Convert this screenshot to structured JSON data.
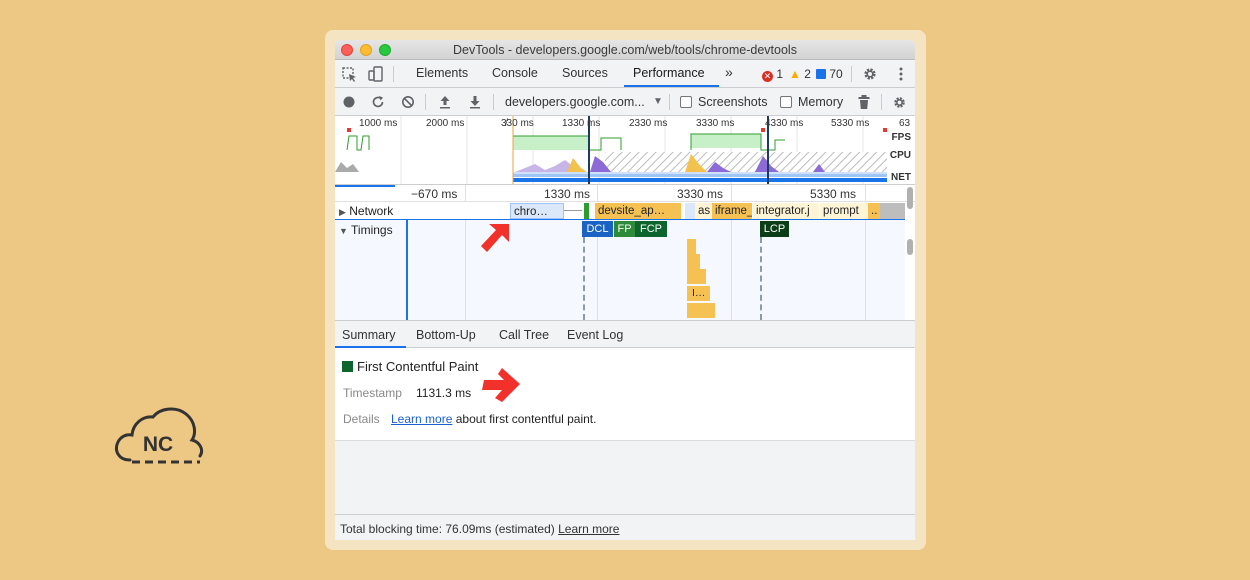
{
  "window": {
    "title": "DevTools - developers.google.com/web/tools/chrome-devtools"
  },
  "panel_tabs": [
    "Elements",
    "Console",
    "Sources",
    "Performance"
  ],
  "more_tabs_glyph": "»",
  "badges": {
    "errors": "1",
    "warnings": "2",
    "messages": "70"
  },
  "toolbar": {
    "url_select": "developers.google.com...",
    "screenshots_label": "Screenshots",
    "memory_label": "Memory"
  },
  "overview": {
    "ticks": [
      "1000 ms",
      "2000 ms",
      "3̸30 ms",
      "1330 ms",
      "2330 ms",
      "3330 ms",
      "4330 ms",
      "5330 ms",
      "63"
    ],
    "labels": {
      "fps": "FPS",
      "cpu": "CPU",
      "net": "NET"
    }
  },
  "ruler_ticks": [
    "−670 ms",
    "1330 ms",
    "3330 ms",
    "5330 ms"
  ],
  "tracks": {
    "network_label": "Network",
    "timings_label": "Timings",
    "network_bars": [
      "chro…",
      "devsite_ap…",
      "as",
      "iframe_",
      "integrator.j",
      "prompt",
      ".."
    ],
    "markers": [
      "DCL",
      "FP",
      "FCP",
      "LCP"
    ],
    "flame_label": "I…"
  },
  "bottom_tabs": [
    "Summary",
    "Bottom-Up",
    "Call Tree",
    "Event Log"
  ],
  "summary": {
    "title": "First Contentful Paint",
    "timestamp_key": "Timestamp",
    "timestamp_value": "1131.3 ms",
    "details_key": "Details",
    "learn_more": "Learn more",
    "details_rest": "about first contentful paint."
  },
  "footer": {
    "text": "Total blocking time: 76.09ms (estimated)",
    "learn_more": "Learn more"
  },
  "logo": {
    "text": "NC"
  },
  "colors": {
    "background": "#EDC884",
    "accent_blue": "#1a73e8",
    "fcp_green": "#0d652d",
    "arrow_red": "#f2322a"
  }
}
